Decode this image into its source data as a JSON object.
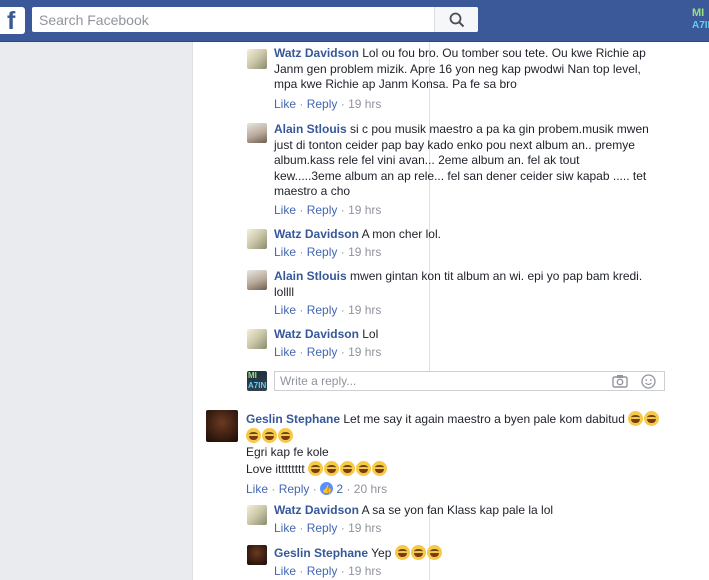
{
  "topbar": {
    "logo": "f",
    "search_placeholder": "Search Facebook",
    "corner_avatar": {
      "line1": "MI",
      "line2": "A7IN"
    }
  },
  "actions_text": {
    "like": "Like",
    "reply": "Reply",
    "sep": "·"
  },
  "comments": [
    {
      "name": "Watz Davidson",
      "text": "Lol ou fou bro. Ou tomber sou tete. Ou kwe Richie ap Janm gen problem mizik. Apre 16 yon neg kap pwodwi Nan top level, mpa kwe Richie ap Janm Konsa. Pa fe sa bro",
      "time": "19 hrs"
    },
    {
      "name": "Alain Stlouis",
      "text": "si c pou musik maestro a pa ka gin probem.musik mwen just di tonton ceider pap bay kado enko pou next album an.. premye album.kass rele fel vini avan... 2eme album an. fel ak tout kew.....3eme album an ap rele... fel san dener ceider siw kapab ..... tet maestro a cho",
      "time": "19 hrs"
    },
    {
      "name": "Watz Davidson",
      "text": "A mon cher lol.",
      "time": "19 hrs"
    },
    {
      "name": "Alain Stlouis",
      "text": "mwen gintan kon tit album an wi. epi yo pap bam kredi. lollll",
      "time": "19 hrs"
    },
    {
      "name": "Watz Davidson",
      "text": "Lol",
      "time": "19 hrs"
    }
  ],
  "reply_box": {
    "placeholder": "Write a reply...",
    "avatar": {
      "line1": "MI",
      "line2": "A7IN"
    }
  },
  "top_comment": {
    "name": "Geslin Stephane",
    "text": "Let me say it again maestro a byen pale kom dabitud",
    "line2": "Egri kap fe kole",
    "line3": "Love itttttttt",
    "reactions": "2",
    "time": "20 hrs",
    "replies": [
      {
        "name": "Watz Davidson",
        "text": "A sa se yon fan Klass kap pale la lol",
        "time": "19 hrs"
      },
      {
        "name": "Geslin Stephane",
        "text": "Yep",
        "time": "19 hrs"
      }
    ]
  },
  "colors": {
    "brand": "#3b5998",
    "link": "#365899",
    "meta": "#90949c",
    "background": "#e9ebee"
  },
  "icons": [
    "search-icon",
    "camera-icon",
    "smiley-icon",
    "like-reaction-icon",
    "laughing-emoji"
  ]
}
